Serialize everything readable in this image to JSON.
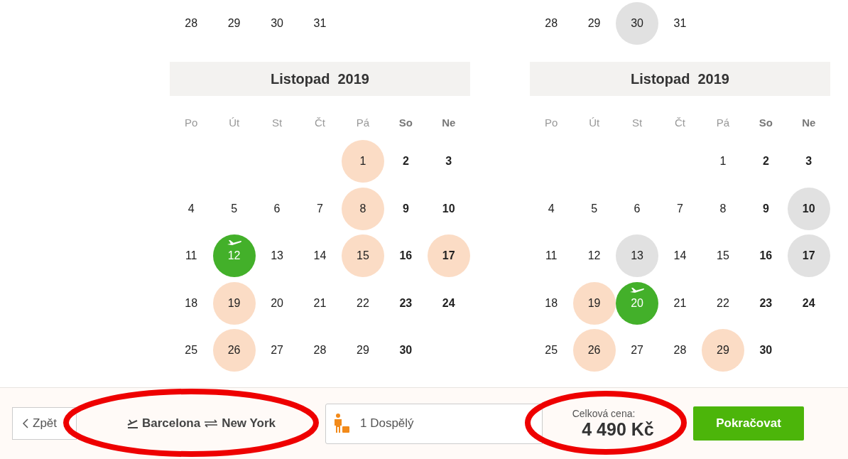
{
  "calendars": [
    {
      "previous_days": [
        {
          "label": "28",
          "kind": "plain"
        },
        {
          "label": "29",
          "kind": "plain"
        },
        {
          "label": "30",
          "kind": "plain"
        },
        {
          "label": "31",
          "kind": "plain"
        }
      ],
      "title": "Listopad  2019",
      "weekdays": [
        "Po",
        "Út",
        "St",
        "Čt",
        "Pá",
        "So",
        "Ne"
      ],
      "weeks": [
        [
          {
            "kind": "blank"
          },
          {
            "kind": "blank"
          },
          {
            "kind": "blank"
          },
          {
            "kind": "blank"
          },
          {
            "label": "1",
            "kind": "cheap"
          },
          {
            "label": "2",
            "kind": "plain"
          },
          {
            "label": "3",
            "kind": "plain"
          }
        ],
        [
          {
            "label": "4",
            "kind": "plain"
          },
          {
            "label": "5",
            "kind": "plain"
          },
          {
            "label": "6",
            "kind": "plain"
          },
          {
            "label": "7",
            "kind": "plain"
          },
          {
            "label": "8",
            "kind": "cheap"
          },
          {
            "label": "9",
            "kind": "plain"
          },
          {
            "label": "10",
            "kind": "plain"
          }
        ],
        [
          {
            "label": "11",
            "kind": "plain"
          },
          {
            "label": "12",
            "kind": "chosen"
          },
          {
            "label": "13",
            "kind": "plain"
          },
          {
            "label": "14",
            "kind": "plain"
          },
          {
            "label": "15",
            "kind": "cheap"
          },
          {
            "label": "16",
            "kind": "plain"
          },
          {
            "label": "17",
            "kind": "cheap"
          }
        ],
        [
          {
            "label": "18",
            "kind": "plain"
          },
          {
            "label": "19",
            "kind": "cheap"
          },
          {
            "label": "20",
            "kind": "plain"
          },
          {
            "label": "21",
            "kind": "plain"
          },
          {
            "label": "22",
            "kind": "plain"
          },
          {
            "label": "23",
            "kind": "plain"
          },
          {
            "label": "24",
            "kind": "plain"
          }
        ],
        [
          {
            "label": "25",
            "kind": "plain"
          },
          {
            "label": "26",
            "kind": "cheap"
          },
          {
            "label": "27",
            "kind": "plain"
          },
          {
            "label": "28",
            "kind": "plain"
          },
          {
            "label": "29",
            "kind": "plain"
          },
          {
            "label": "30",
            "kind": "plain"
          }
        ]
      ]
    },
    {
      "previous_days": [
        {
          "label": "28",
          "kind": "plain"
        },
        {
          "label": "29",
          "kind": "plain"
        },
        {
          "label": "30",
          "kind": "grey"
        },
        {
          "label": "31",
          "kind": "plain"
        }
      ],
      "title": "Listopad  2019",
      "weekdays": [
        "Po",
        "Út",
        "St",
        "Čt",
        "Pá",
        "So",
        "Ne"
      ],
      "weeks": [
        [
          {
            "kind": "blank"
          },
          {
            "kind": "blank"
          },
          {
            "kind": "blank"
          },
          {
            "kind": "blank"
          },
          {
            "label": "1",
            "kind": "plain"
          },
          {
            "label": "2",
            "kind": "plain"
          },
          {
            "label": "3",
            "kind": "plain"
          }
        ],
        [
          {
            "label": "4",
            "kind": "plain"
          },
          {
            "label": "5",
            "kind": "plain"
          },
          {
            "label": "6",
            "kind": "plain"
          },
          {
            "label": "7",
            "kind": "plain"
          },
          {
            "label": "8",
            "kind": "plain"
          },
          {
            "label": "9",
            "kind": "plain"
          },
          {
            "label": "10",
            "kind": "grey"
          }
        ],
        [
          {
            "label": "11",
            "kind": "plain"
          },
          {
            "label": "12",
            "kind": "plain"
          },
          {
            "label": "13",
            "kind": "grey"
          },
          {
            "label": "14",
            "kind": "plain"
          },
          {
            "label": "15",
            "kind": "plain"
          },
          {
            "label": "16",
            "kind": "plain"
          },
          {
            "label": "17",
            "kind": "grey"
          }
        ],
        [
          {
            "label": "18",
            "kind": "plain"
          },
          {
            "label": "19",
            "kind": "cheap"
          },
          {
            "label": "20",
            "kind": "chosen"
          },
          {
            "label": "21",
            "kind": "plain"
          },
          {
            "label": "22",
            "kind": "plain"
          },
          {
            "label": "23",
            "kind": "plain"
          },
          {
            "label": "24",
            "kind": "plain"
          }
        ],
        [
          {
            "label": "25",
            "kind": "plain"
          },
          {
            "label": "26",
            "kind": "cheap"
          },
          {
            "label": "27",
            "kind": "plain"
          },
          {
            "label": "28",
            "kind": "plain"
          },
          {
            "label": "29",
            "kind": "cheap"
          },
          {
            "label": "30",
            "kind": "plain"
          }
        ]
      ]
    }
  ],
  "bottom_bar": {
    "back_button": "Zpět",
    "route": {
      "from": "Barcelona",
      "to": "New York",
      "circled": true
    },
    "passengers": "1 Dospělý",
    "price": {
      "label": "Celková cena:",
      "value": "4 490 Kč",
      "circled": true
    },
    "continue_button": "Pokračovat"
  }
}
